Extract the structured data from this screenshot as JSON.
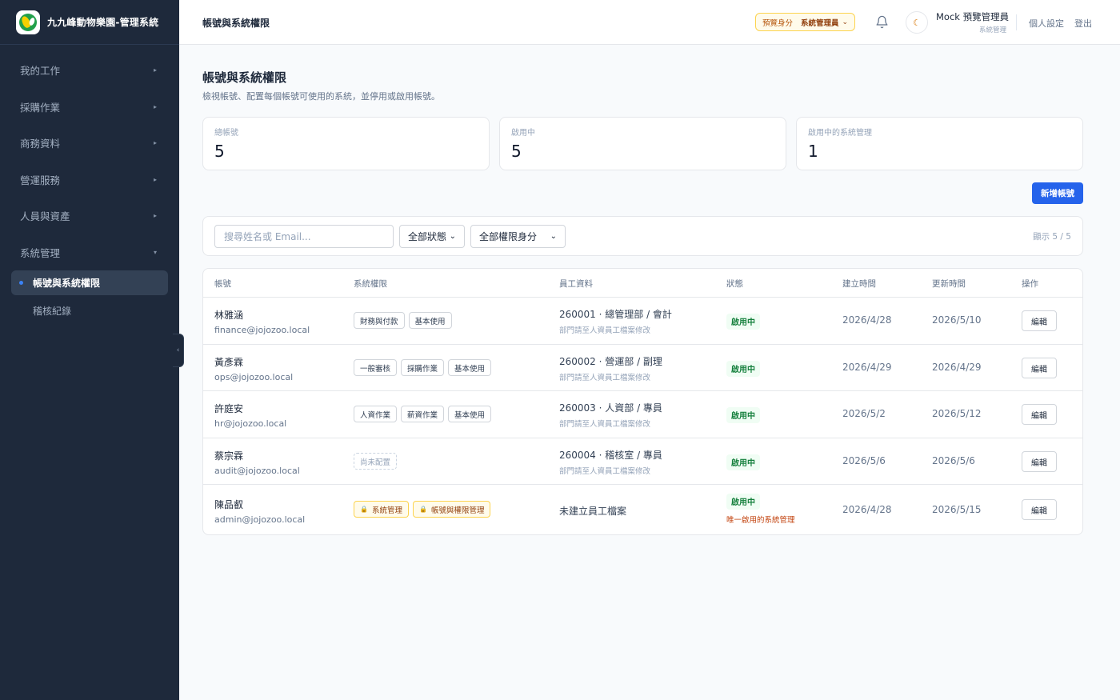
{
  "sidebar": {
    "brand_title": "九九峰動物樂園-管理系統",
    "nav": [
      {
        "label": "我的工作"
      },
      {
        "label": "採購作業"
      },
      {
        "label": "商務資料"
      },
      {
        "label": "營運服務"
      },
      {
        "label": "人員與資產"
      },
      {
        "label": "系統管理"
      }
    ],
    "sub_items": [
      {
        "label": "帳號與系統權限"
      },
      {
        "label": "稽核紀錄"
      }
    ],
    "collapse_glyph": "‹"
  },
  "header": {
    "title": "帳號與系統權限",
    "preview_label": "預覽身分",
    "preview_value": "系統管理員",
    "user_name": "Mock 預覽管理員",
    "user_role": "系統管理",
    "settings_link": "個人設定",
    "logout_link": "登出"
  },
  "page": {
    "title": "帳號與系統權限",
    "subtitle": "檢視帳號、配置每個帳號可使用的系統，並停用或啟用帳號。"
  },
  "stats": [
    {
      "label": "總帳號",
      "value": "5"
    },
    {
      "label": "啟用中",
      "value": "5"
    },
    {
      "label": "啟用中的系統管理",
      "value": "1"
    }
  ],
  "actions": {
    "new_account": "新增帳號"
  },
  "filters": {
    "search_placeholder": "搜尋姓名或 Email...",
    "status_select": "全部狀態",
    "role_select": "全部權限身分",
    "count": "顯示 5 / 5"
  },
  "table": {
    "headers": [
      "帳號",
      "系統權限",
      "員工資料",
      "狀態",
      "建立時間",
      "更新時間",
      "操作"
    ],
    "rows": [
      {
        "name": "林雅涵",
        "email": "finance@jojozoo.local",
        "tags": [
          "財務與付款",
          "基本使用"
        ],
        "employee": "260001 · 總管理部 / 會計",
        "employee_note": "部門請至人資員工檔案修改",
        "status": "啟用中",
        "status_note": "",
        "created": "2026/4/28",
        "updated": "2026/5/10",
        "action": "編輯"
      },
      {
        "name": "黃彥霖",
        "email": "ops@jojozoo.local",
        "tags": [
          "一般審核",
          "採購作業",
          "基本使用"
        ],
        "employee": "260002 · 營運部 / 副理",
        "employee_note": "部門請至人資員工檔案修改",
        "status": "啟用中",
        "status_note": "",
        "created": "2026/4/29",
        "updated": "2026/4/29",
        "action": "編輯"
      },
      {
        "name": "許庭安",
        "email": "hr@jojozoo.local",
        "tags": [
          "人資作業",
          "薪資作業",
          "基本使用"
        ],
        "employee": "260003 · 人資部 / 專員",
        "employee_note": "部門請至人資員工檔案修改",
        "status": "啟用中",
        "status_note": "",
        "created": "2026/5/2",
        "updated": "2026/5/12",
        "action": "編輯"
      },
      {
        "name": "蔡宗霖",
        "email": "audit@jojozoo.local",
        "tags": [
          "尚未配置"
        ],
        "employee": "260004 · 稽核室 / 專員",
        "employee_note": "部門請至人資員工檔案修改",
        "status": "啟用中",
        "status_note": "",
        "created": "2026/5/6",
        "updated": "2026/5/6",
        "action": "編輯"
      },
      {
        "name": "陳品叡",
        "email": "admin@jojozoo.local",
        "tags": [
          "系統管理",
          "帳號與權限管理"
        ],
        "employee": "未建立員工檔案",
        "employee_note": "",
        "status": "啟用中",
        "status_note": "唯一啟用的系統管理",
        "created": "2026/4/28",
        "updated": "2026/5/15",
        "action": "編輯"
      }
    ]
  },
  "icons": {
    "bell": "bell-icon",
    "moon": "moon-icon",
    "lock": "lock-icon",
    "caret_right": "caret-right-icon",
    "caret_down": "caret-down-icon",
    "chevron_down": "chevron-down-icon"
  },
  "colors": {
    "sidebar_bg": "#1e293b",
    "primary": "#2563eb",
    "status_green": "#15803d",
    "warn": "#b45309"
  }
}
